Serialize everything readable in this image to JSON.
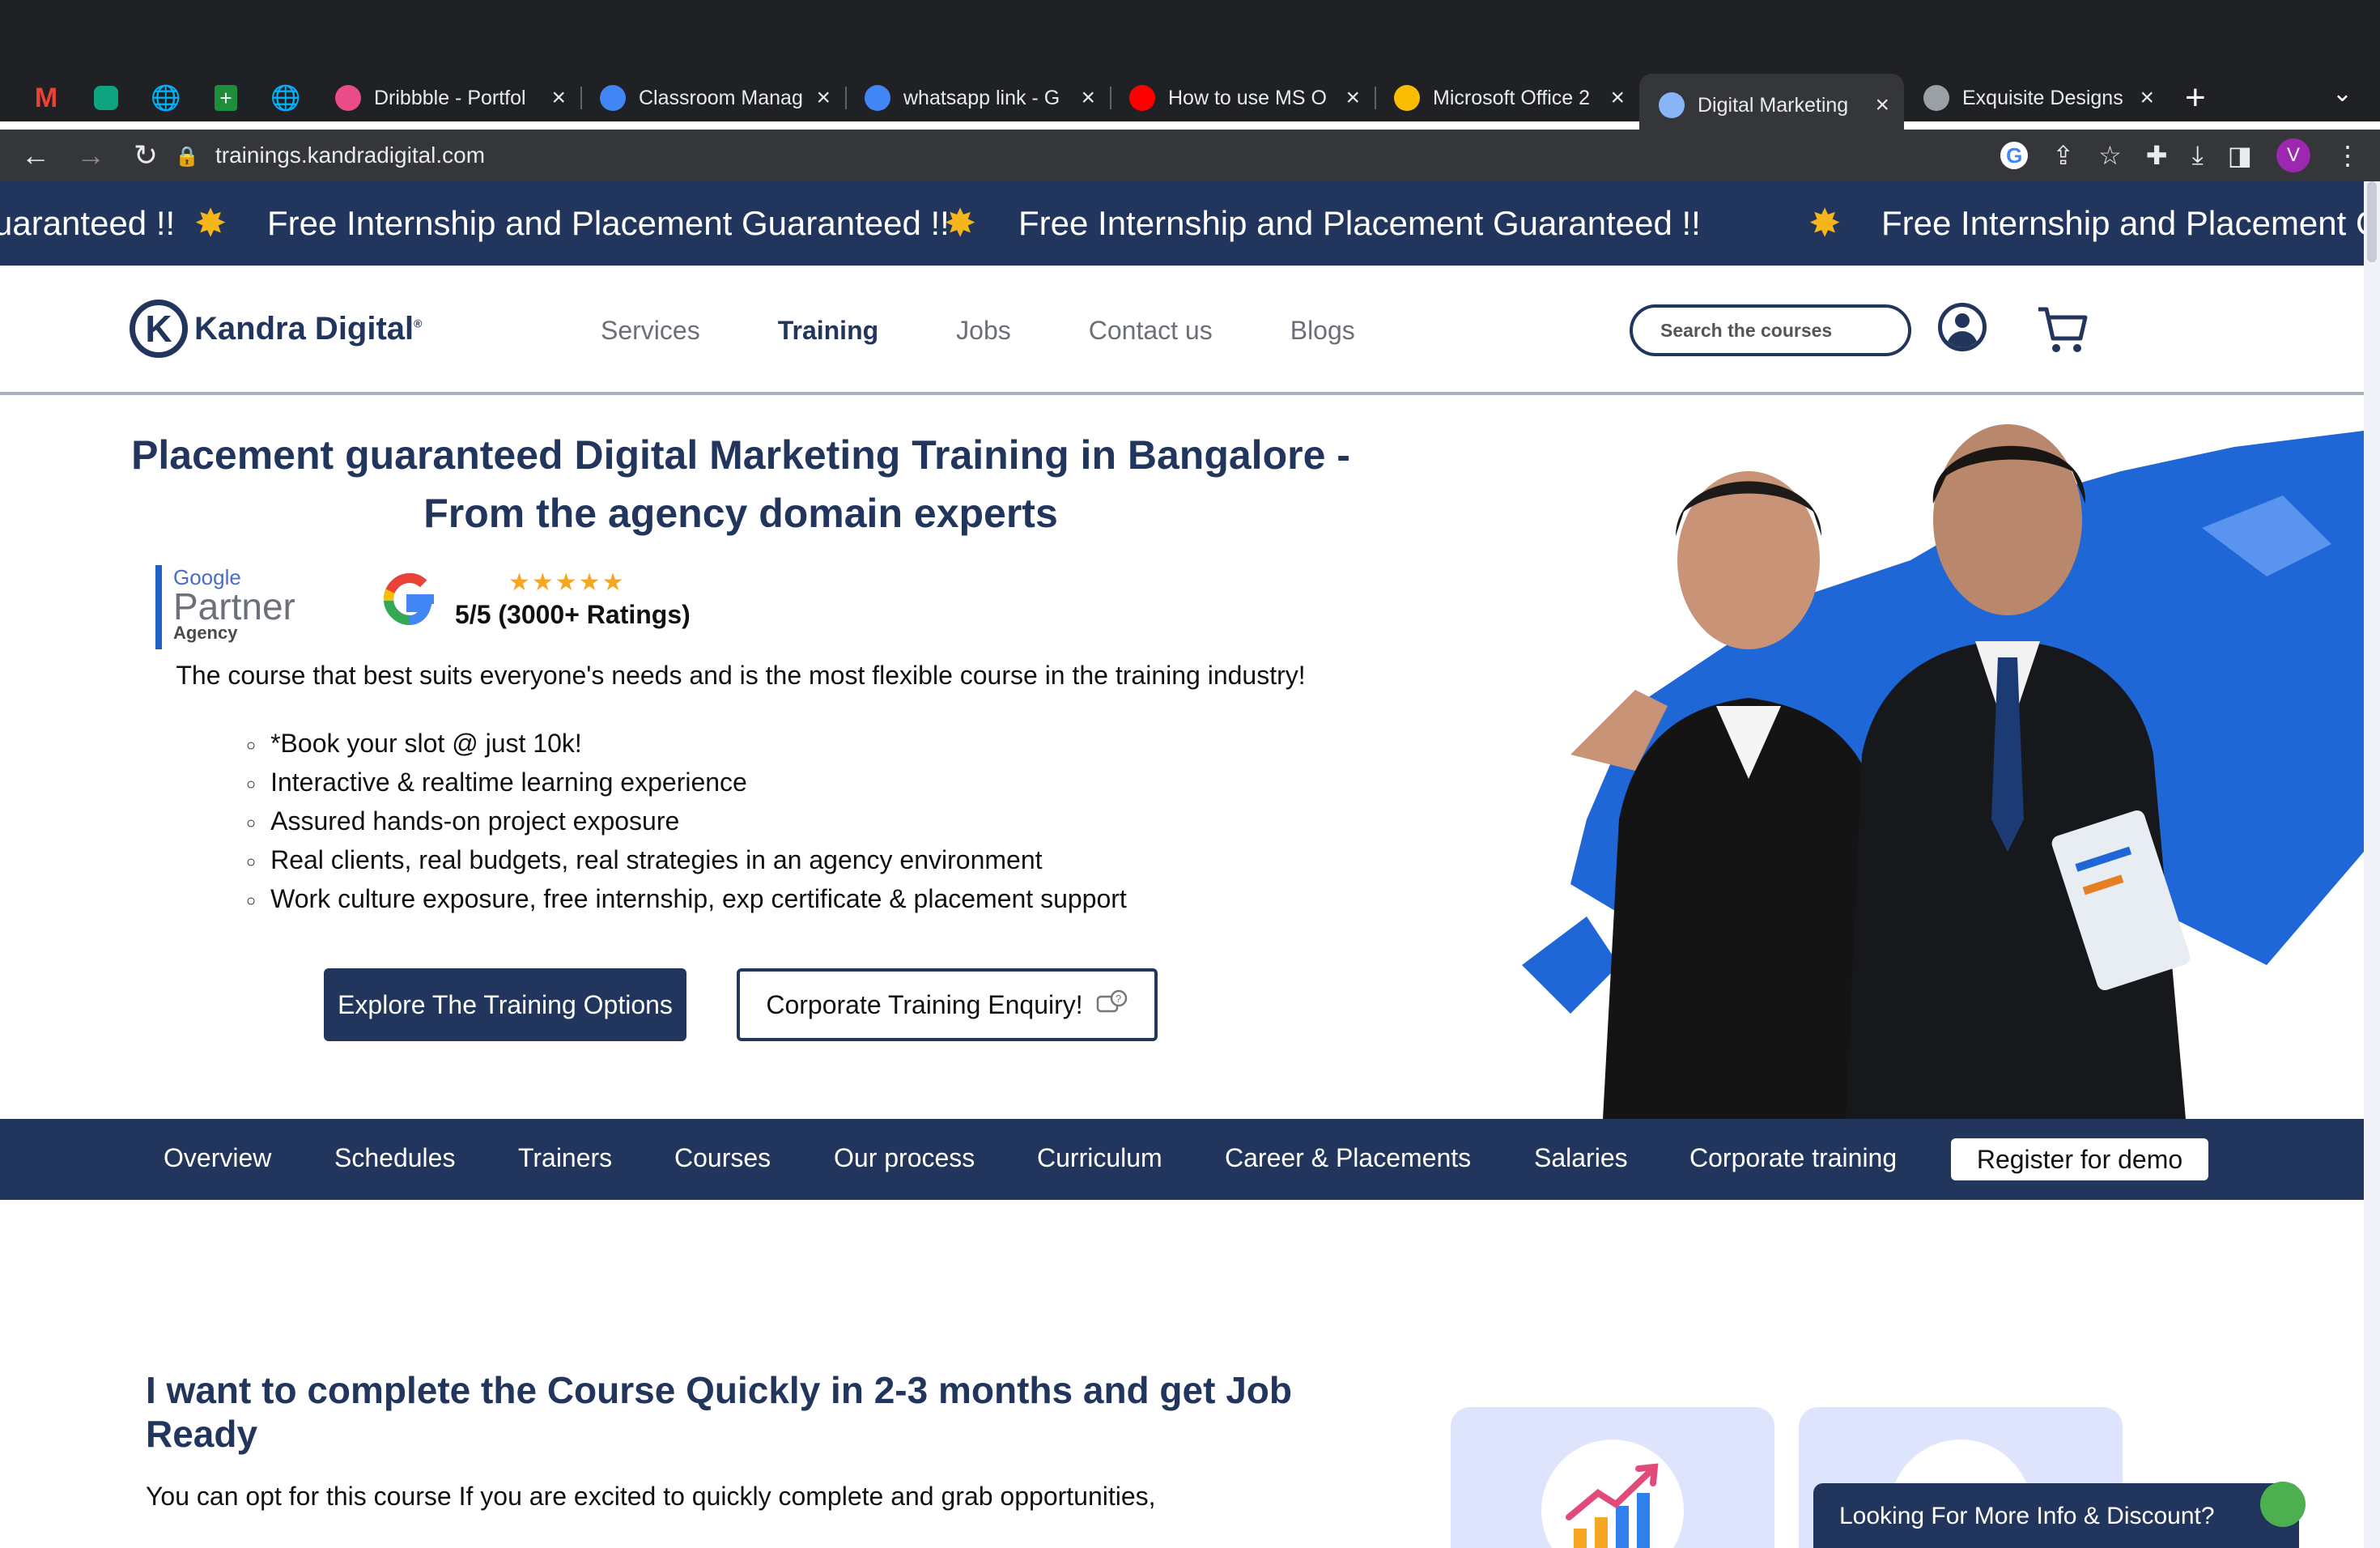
{
  "browser": {
    "pinned_tabs": [
      "gmail-icon",
      "openai-icon",
      "globe-icon",
      "sheets-icon",
      "globe-icon"
    ],
    "tabs": [
      {
        "title": "Dribbble - Portfol",
        "icon": "dribbble-icon",
        "color": "#ea4c89"
      },
      {
        "title": "Classroom Manag",
        "icon": "google-icon",
        "color": "#4285f4"
      },
      {
        "title": "whatsapp link - G",
        "icon": "google-icon",
        "color": "#4285f4"
      },
      {
        "title": "How to use MS O",
        "icon": "youtube-icon",
        "color": "#ff0000"
      },
      {
        "title": "Microsoft Office 2",
        "icon": "drive-icon",
        "color": "#fbbc04"
      },
      {
        "title": "Digital Marketing",
        "icon": "kandra-icon",
        "color": "#8ab4f8",
        "active": true
      },
      {
        "title": "Exquisite Designs",
        "icon": "site-icon",
        "color": "#9aa0a6"
      }
    ],
    "url": "trainings.kandradigital.com",
    "profile_initial": "V"
  },
  "marquee": {
    "text": "Free Internship and Placement Guaranteed !!",
    "left_fragment": "uaranteed !!",
    "right_fragment": "Free Internship and Placement Gu"
  },
  "header": {
    "logo_text": "Kandra Digital",
    "logo_mark": "®",
    "nav": [
      "Services",
      "Training",
      "Jobs",
      "Contact us",
      "Blogs"
    ],
    "active_nav": "Training",
    "search_placeholder": "Search the courses"
  },
  "hero": {
    "title": "Placement guaranteed Digital Marketing Training in Bangalore - From the agency domain experts",
    "badge": {
      "line1": "Google",
      "line2": "Partner",
      "line3": "Agency"
    },
    "rating": {
      "stars": "★★★★★",
      "text": "5/5 (3000+ Ratings)"
    },
    "tagline": "The course that best suits everyone's needs and is the most flexible course in the training industry!",
    "bullets": [
      "*Book your slot @ just 10k!",
      "Interactive & realtime learning experience",
      "Assured hands-on project exposure",
      "Real clients, real budgets, real strategies in an agency environment",
      "Work culture exposure, free internship, exp certificate & placement support"
    ],
    "primary_button": "Explore The Training Options",
    "secondary_button": "Corporate Training Enquiry!"
  },
  "subnav": {
    "items": [
      "Overview",
      "Schedules",
      "Trainers",
      "Courses",
      "Our process",
      "Curriculum",
      "Career & Placements",
      "Salaries",
      "Corporate training"
    ],
    "register": "Register for demo"
  },
  "section": {
    "title": "I want to complete the Course Quickly in 2-3 months and get Job Ready",
    "text": "You can opt for this course If you are excited to quickly complete and grab opportunities,"
  },
  "chat": {
    "text": "Looking For More Info & Discount?"
  },
  "colors": {
    "brand_navy": "#22365d",
    "accent_gold": "#f5b51b",
    "card_blue": "#dde4fb"
  }
}
